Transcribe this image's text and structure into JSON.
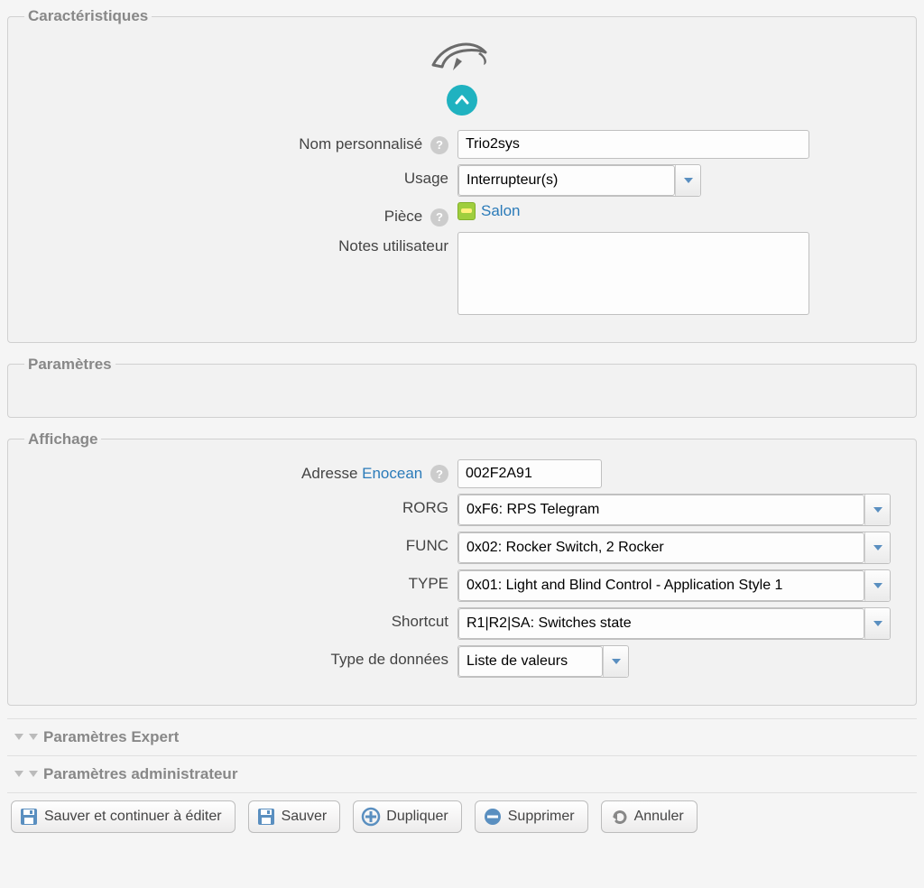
{
  "sections": {
    "characteristics": "Caractéristiques",
    "parameters": "Paramètres",
    "display": "Affichage",
    "expert": "Paramètres Expert",
    "admin": "Paramètres administrateur"
  },
  "characteristics": {
    "name_label": "Nom personnalisé",
    "name_value": "Trio2sys",
    "usage_label": "Usage",
    "usage_value": "Interrupteur(s)",
    "room_label": "Pièce",
    "room_value": "Salon",
    "notes_label": "Notes utilisateur",
    "notes_value": ""
  },
  "display": {
    "address_label_pre": "Adresse ",
    "address_link": "Enocean",
    "address_value": "002F2A91",
    "rorg_label": "RORG",
    "rorg_value": "0xF6: RPS Telegram",
    "func_label": "FUNC",
    "func_value": "0x02: Rocker Switch, 2 Rocker",
    "type_label": "TYPE",
    "type_value": "0x01: Light and Blind Control - Application Style 1",
    "shortcut_label": "Shortcut",
    "shortcut_value": "R1|R2|SA: Switches state",
    "datatype_label": "Type de données",
    "datatype_value": "Liste de valeurs"
  },
  "buttons": {
    "save_continue": "Sauver et continuer à éditer",
    "save": "Sauver",
    "duplicate": "Dupliquer",
    "delete": "Supprimer",
    "cancel": "Annuler"
  }
}
